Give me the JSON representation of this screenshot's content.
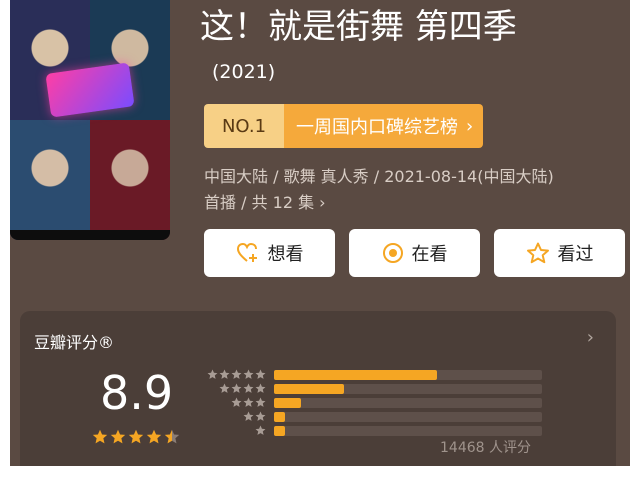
{
  "header": {
    "title": "这！就是街舞 第四季",
    "year": "(2021)"
  },
  "rank": {
    "badge": "NO.1",
    "label": "一周国内口碑综艺榜",
    "chevron": "›"
  },
  "meta": {
    "line1": "中国大陆 / 歌舞 真人秀 / 2021-08-14(中国大陆)",
    "line2": "首播 / 共 12 集 ›"
  },
  "actions": [
    {
      "label": "想看",
      "icon": "heart-plus-icon"
    },
    {
      "label": "在看",
      "icon": "target-icon"
    },
    {
      "label": "看过",
      "icon": "star-outline-icon"
    }
  ],
  "rating": {
    "title": "豆瓣评分®",
    "score": "8.9",
    "stars": 4.5,
    "votes_text": "14468 人评分",
    "distribution": [
      {
        "stars": 5,
        "fraction": 0.61
      },
      {
        "stars": 4,
        "fraction": 0.26
      },
      {
        "stars": 3,
        "fraction": 0.1
      },
      {
        "stars": 2,
        "fraction": 0.04
      },
      {
        "stars": 1,
        "fraction": 0.04
      }
    ]
  },
  "colors": {
    "background": "#5a4a42",
    "accent": "#f5a623",
    "rank_badge": "#f7d086",
    "rank_bar": "#f5a93b"
  }
}
